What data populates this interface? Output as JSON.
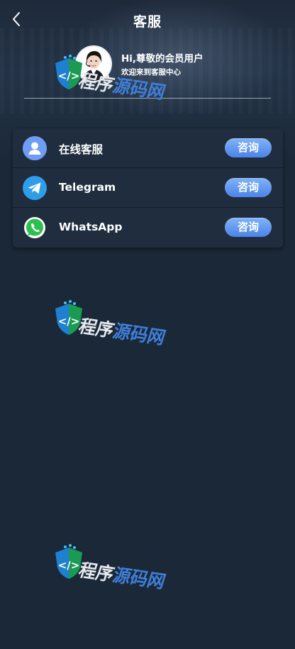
{
  "header": {
    "title": "客服",
    "back_icon": "chevron-left-icon"
  },
  "profile": {
    "greeting": "Hi,尊敬的会员用户",
    "subtitle": "欢迎来到客服中心"
  },
  "services": [
    {
      "label": "在线客服",
      "icon": "user-support-icon",
      "icon_color": "#5b8cf0",
      "button_label": "咨询"
    },
    {
      "label": "Telegram",
      "icon": "telegram-icon",
      "icon_color": "#2f9ee8",
      "button_label": "咨询"
    },
    {
      "label": "WhatsApp",
      "icon": "whatsapp-icon",
      "icon_color": "#2ec04f",
      "button_label": "咨询"
    }
  ],
  "watermark": {
    "part1": "程序",
    "part2": "源码网"
  },
  "colors": {
    "background": "#1b2838",
    "card": "#1f2d3e",
    "button": "#5b8fee"
  }
}
